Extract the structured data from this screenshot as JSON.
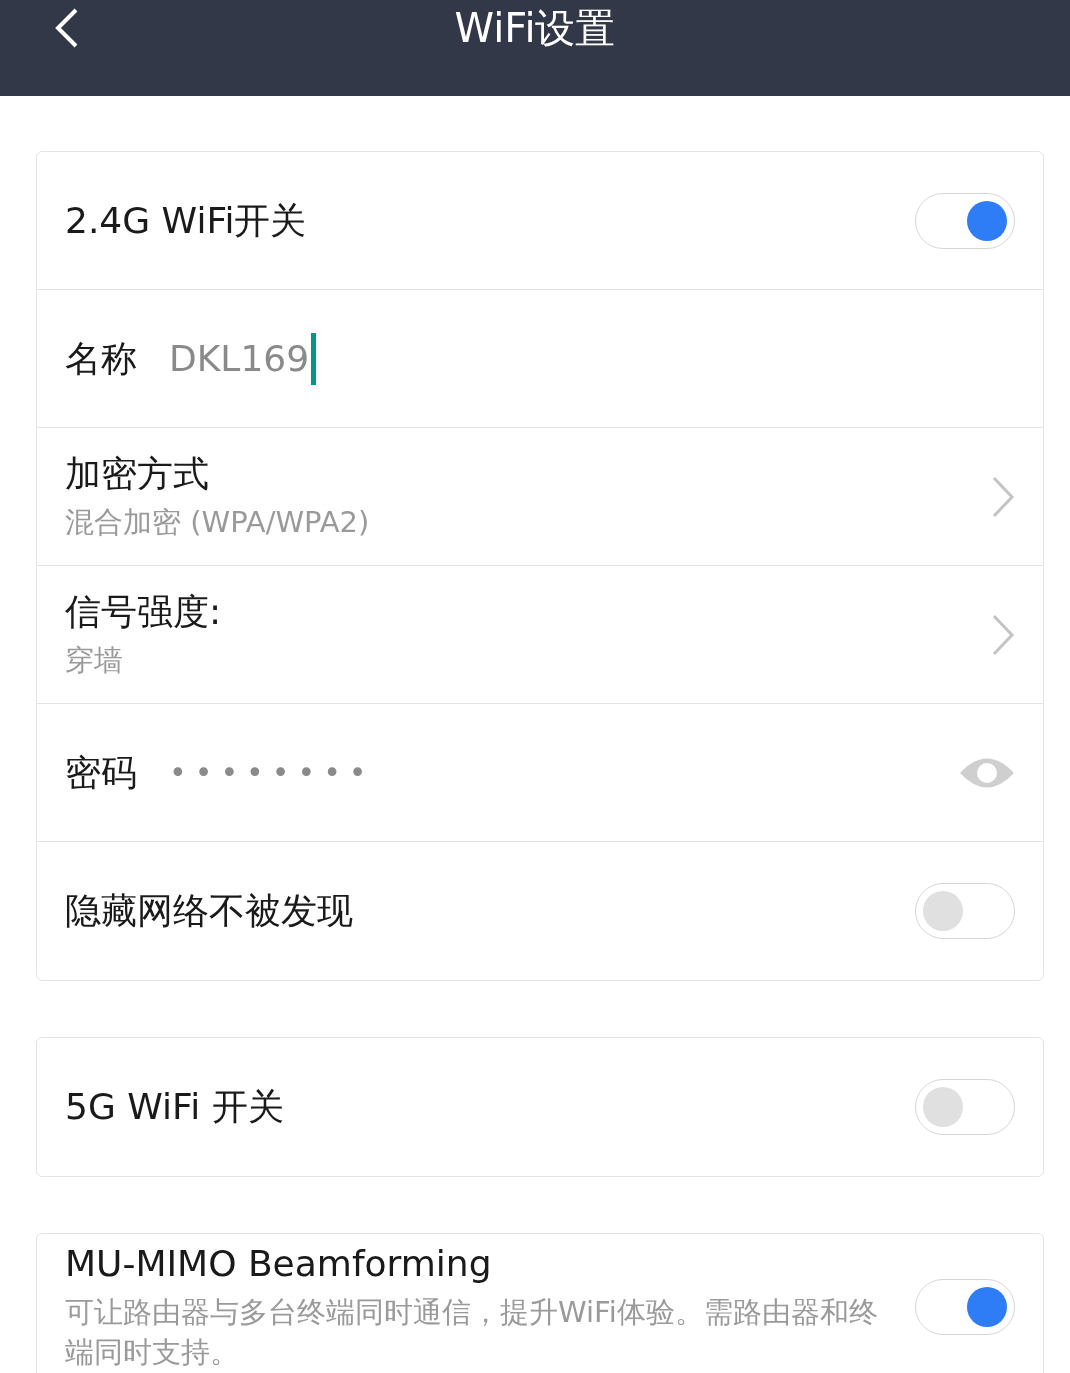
{
  "header": {
    "title": "WiFi设置"
  },
  "sections": [
    {
      "rows": [
        {
          "kind": "toggle",
          "label": "2.4G WiFi开关",
          "on": true
        },
        {
          "kind": "input",
          "label": "名称",
          "value": "DKL169"
        },
        {
          "kind": "select",
          "label": "加密方式",
          "value": "混合加密 (WPA/WPA2)"
        },
        {
          "kind": "select",
          "label": "信号强度:",
          "value": "穿墙"
        },
        {
          "kind": "password",
          "label": "密码",
          "value": "••••••••"
        },
        {
          "kind": "toggle",
          "label": "隐藏网络不被发现",
          "on": false
        }
      ]
    },
    {
      "rows": [
        {
          "kind": "toggle",
          "label": "5G WiFi 开关",
          "on": false
        }
      ]
    },
    {
      "rows": [
        {
          "kind": "toggle",
          "label": "MU-MIMO Beamforming",
          "description": "可让路由器与多台终端同时通信，提升WiFi体验。需路由器和终端同时支持。",
          "on": true
        }
      ]
    }
  ]
}
